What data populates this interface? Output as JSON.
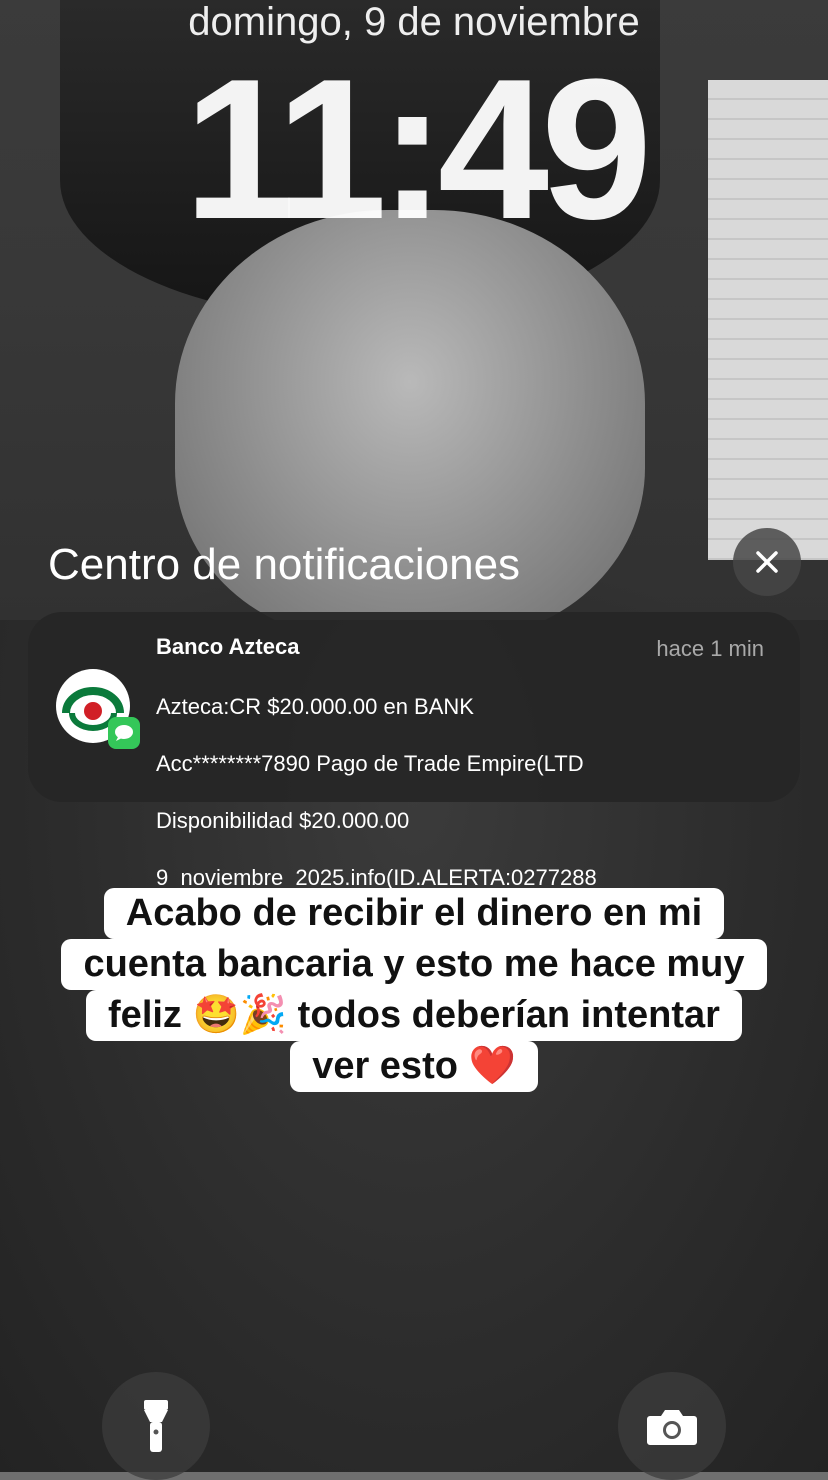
{
  "lockscreen": {
    "date": "domingo, 9 de noviembre",
    "time": "11:49"
  },
  "notification_center": {
    "title": "Centro de notificaciones"
  },
  "notification": {
    "sender": "Banco Azteca",
    "time_ago": "hace 1 min",
    "lines": [
      "Azteca:CR $20.000.00 en BANK",
      "Acc********7890 Pago de Trade Empire(LTD",
      "Disponibilidad $20.000.00",
      "9_noviembre_2025.info(ID.ALERTA:0277288"
    ],
    "app_icon": "banco-azteca-logo",
    "badge_icon": "messages-icon"
  },
  "caption": {
    "lines": [
      "Acabo de recibir el dinero en mi",
      "cuenta bancaria y esto me hace muy",
      "feliz 🤩🎉 todos deberían intentar",
      "ver esto ❤️"
    ]
  },
  "quick_actions": {
    "left_icon": "flashlight-icon",
    "right_icon": "camera-icon"
  },
  "colors": {
    "notification_bg": "#262626",
    "badge_green": "#34c759",
    "logo_green": "#0b7a3b",
    "logo_red": "#d11f26"
  }
}
